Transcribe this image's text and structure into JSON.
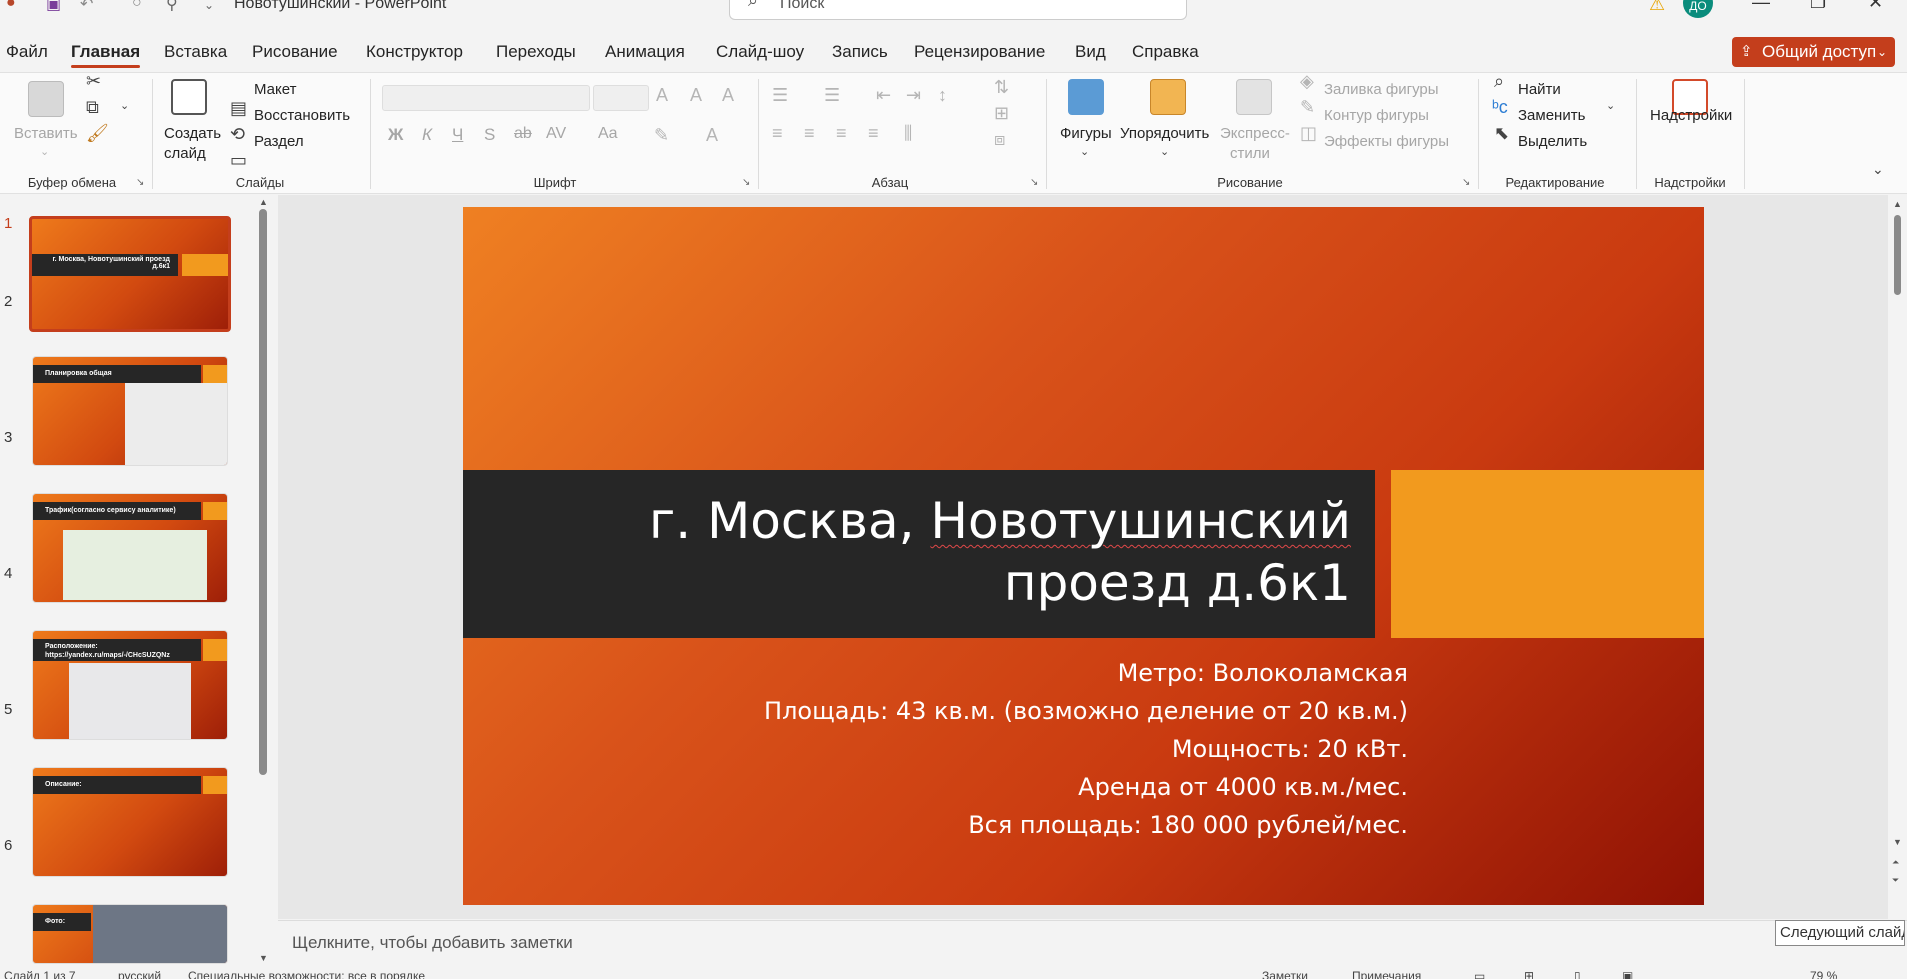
{
  "window": {
    "title": "Новотушинский - PowerPoint",
    "search_placeholder": "Поиск",
    "user_initials": "ДО"
  },
  "menu": {
    "items": [
      "Файл",
      "Главная",
      "Вставка",
      "Рисование",
      "Конструктор",
      "Переходы",
      "Анимация",
      "Слайд-шоу",
      "Запись",
      "Рецензирование",
      "Вид",
      "Справка"
    ],
    "active": "Главная",
    "share_label": "Общий доступ"
  },
  "ribbon": {
    "clipboard": {
      "paste": "Вставить",
      "group": "Буфер обмена"
    },
    "slides": {
      "new_slide_1": "Создать",
      "new_slide_2": "слайд",
      "layout": "Макет",
      "reset": "Восстановить",
      "section": "Раздел",
      "group": "Слайды"
    },
    "font": {
      "group": "Шрифт",
      "bold": "Ж",
      "italic": "К",
      "underline": "Ч",
      "shadow": "S",
      "strike": "ab",
      "spacing": "AV",
      "case": "Aa"
    },
    "paragraph": {
      "group": "Абзац"
    },
    "drawing": {
      "shapes": "Фигуры",
      "arrange": "Упорядочить",
      "quick_styles_1": "Экспресс-",
      "quick_styles_2": "стили",
      "fill": "Заливка фигуры",
      "outline": "Контур фигуры",
      "effects": "Эффекты фигуры",
      "group": "Рисование"
    },
    "editing": {
      "find": "Найти",
      "replace": "Заменить",
      "select": "Выделить",
      "group": "Редактирование"
    },
    "addins": {
      "button": "Надстройки",
      "group": "Надстройки"
    }
  },
  "thumbnails": [
    {
      "num": "1",
      "title": "г. Москва, Новотушинский проезд д.6к1"
    },
    {
      "num": "2",
      "title": "Планировка общая"
    },
    {
      "num": "3",
      "title": "Трафик(согласно сервису аналитике)"
    },
    {
      "num": "4",
      "title": "Расположение: https://yandex.ru/maps/-/CHcSUZQNz"
    },
    {
      "num": "5",
      "title": "Описание:"
    },
    {
      "num": "6",
      "title": "Фото:"
    }
  ],
  "slide": {
    "title_part1": "г. Москва, ",
    "title_part2": "Новотушинский",
    "title_line2": "проезд д.6к1",
    "lines": [
      "Метро: Волоколамская",
      "Площадь: 43 кв.м. (возможно деление от 20 кв.м.)",
      "Мощность: 20 кВт.",
      "Аренда от 4000 кв.м./мес.",
      "Вся площадь: 180 000 рублей/мес."
    ]
  },
  "notes_placeholder": "Щелкните, чтобы добавить заметки",
  "tooltip": "Следующий слайд",
  "status": {
    "slide_counter": "Слайд 1 из 7",
    "language": "русский",
    "accessibility": "Специальные возможности: все в порядке",
    "notes": "Заметки",
    "comments": "Примечания",
    "zoom": "79 %"
  },
  "colors": {
    "accent": "#c43e1c",
    "slide_dark_bar": "#262626",
    "slide_orange": "#f29a1e"
  }
}
